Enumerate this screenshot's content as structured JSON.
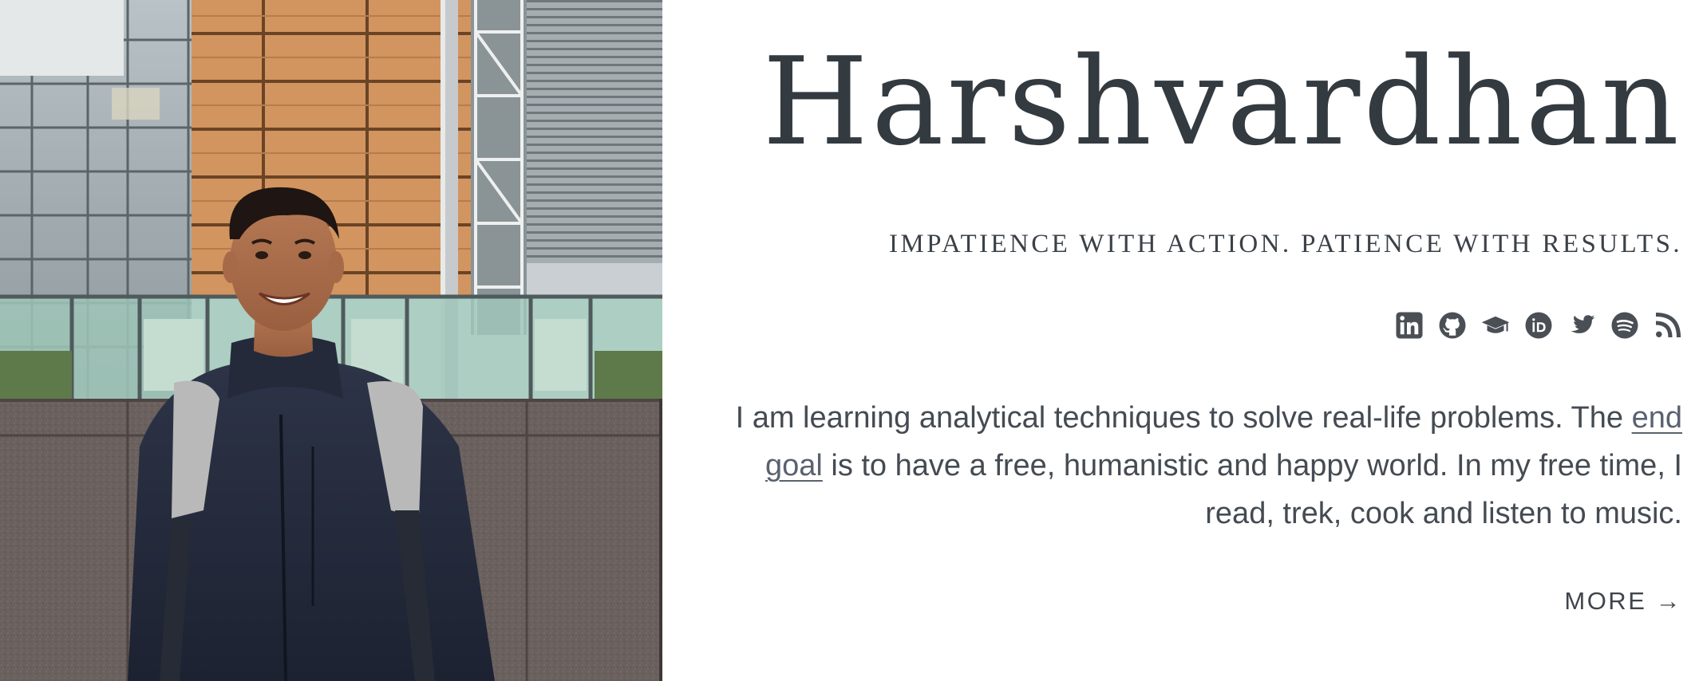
{
  "profile": {
    "name": "Harshvardhan",
    "tagline": "IMPATIENCE WITH ACTION. PATIENCE WITH RESULTS."
  },
  "social": [
    {
      "icon": "linkedin-icon",
      "label": "LinkedIn"
    },
    {
      "icon": "github-icon",
      "label": "GitHub"
    },
    {
      "icon": "graduation-cap-icon",
      "label": "Google Scholar"
    },
    {
      "icon": "orcid-icon",
      "label": "ORCID"
    },
    {
      "icon": "twitter-icon",
      "label": "Twitter"
    },
    {
      "icon": "spotify-icon",
      "label": "Spotify"
    },
    {
      "icon": "rss-icon",
      "label": "RSS"
    }
  ],
  "bio": {
    "before_link": "I am learning analytical techniques to solve real-life problems. The ",
    "link_text": "end goal",
    "after_link": " is to have a free, humanistic and happy world. In my free time, I read, trek, cook and listen to music."
  },
  "more_label": "MORE →",
  "colors": {
    "text": "#3b4148",
    "link": "#5a6170",
    "icon": "#4a4f56"
  }
}
